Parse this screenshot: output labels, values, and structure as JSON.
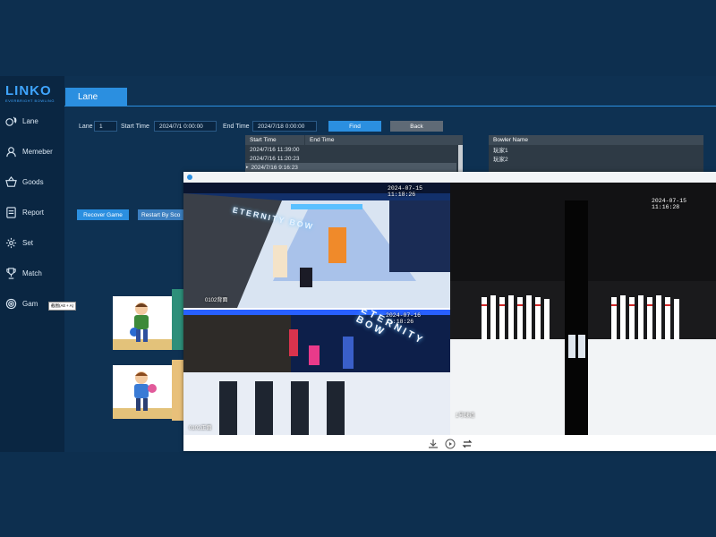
{
  "app": {
    "logo": "LINKO",
    "logo_subtitle": "EVERBRIGHT BOWLING"
  },
  "sidebar": {
    "items": [
      {
        "label": "Lane",
        "icon": "bowling-pins-icon"
      },
      {
        "label": "Memeber",
        "icon": "user-icon"
      },
      {
        "label": "Goods",
        "icon": "basket-icon"
      },
      {
        "label": "Report",
        "icon": "document-icon"
      },
      {
        "label": "Set",
        "icon": "gear-icon"
      },
      {
        "label": "Match",
        "icon": "trophy-icon"
      },
      {
        "label": "Gam",
        "icon": "target-icon"
      }
    ]
  },
  "tooltip": "截图(Alt + A)",
  "main": {
    "active_tab": "Lane",
    "filters": {
      "lane_label": "Lane",
      "lane_value": "1",
      "start_label": "Start Time",
      "start_value": "2024/7/1 0:00:00",
      "end_label": "End Time",
      "end_value": "2024/7/18 0:00:00",
      "find_label": "Find",
      "back_label": "Back"
    },
    "games_table": {
      "headers": [
        "Start Time",
        "End Time"
      ],
      "rows": [
        {
          "start": "2024/7/16 11:39:00",
          "end": ""
        },
        {
          "start": "2024/7/16 11:20:23",
          "end": ""
        },
        {
          "start": "2024/7/16 9:16:23",
          "end": ""
        }
      ],
      "selected_marker": "▸"
    },
    "bowler_table": {
      "header": "Bowler Name",
      "rows": [
        "玩家1",
        "玩家2"
      ]
    },
    "recover_button": "Recover Game",
    "restart_button": "Restart By Sco"
  },
  "video_window": {
    "cameras": [
      {
        "timestamp": "2024-07-15 11:18:26",
        "name": "0102背面"
      },
      {
        "timestamp": "2024-07-15 11:16:28",
        "name": ""
      },
      {
        "timestamp": "2024-07-16 11:18:26",
        "name": "0102正面"
      },
      {
        "timestamp": "",
        "name": "1号球道"
      }
    ],
    "wall_text_1": "ETERNITY BOW",
    "wall_text_2": "ETERNITY BOW"
  },
  "colors": {
    "accent": "#2b8fe0",
    "background": "#0e3152",
    "sidebar": "#0a2642"
  }
}
